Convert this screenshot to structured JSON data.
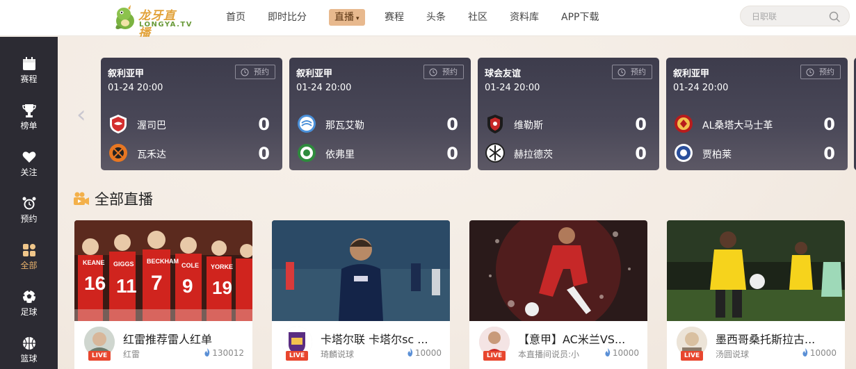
{
  "header": {
    "logo_cn": "龙牙直播",
    "logo_en": "LONGYA.TV",
    "nav": [
      {
        "label": "首页"
      },
      {
        "label": "即时比分"
      },
      {
        "label": "直播",
        "caret": "▾"
      },
      {
        "label": "赛程"
      },
      {
        "label": "头条"
      },
      {
        "label": "社区"
      },
      {
        "label": "资料库"
      },
      {
        "label": "APP下载"
      }
    ],
    "search_placeholder": "日职联"
  },
  "sidebar": {
    "items": [
      {
        "label": "赛程",
        "icon": "calendar-icon"
      },
      {
        "label": "榜单",
        "icon": "trophy-icon"
      },
      {
        "label": "关注",
        "icon": "heart-icon"
      },
      {
        "label": "预约",
        "icon": "alarm-clock-icon"
      },
      {
        "label": "全部",
        "icon": "grid-icon",
        "active": true
      },
      {
        "label": "足球",
        "icon": "football-icon"
      },
      {
        "label": "篮球",
        "icon": "basketball-icon"
      }
    ]
  },
  "matches": [
    {
      "league": "叙利亚甲",
      "time": "01-24 20:00",
      "book": "预约",
      "home": {
        "name": "渥司巴",
        "score": "0"
      },
      "away": {
        "name": "瓦禾达",
        "score": "0"
      }
    },
    {
      "league": "叙利亚甲",
      "time": "01-24 20:00",
      "book": "预约",
      "home": {
        "name": "那瓦艾勒",
        "score": "0"
      },
      "away": {
        "name": "依弗里",
        "score": "0"
      }
    },
    {
      "league": "球会友谊",
      "time": "01-24 20:00",
      "book": "预约",
      "home": {
        "name": "维勒斯",
        "score": "0"
      },
      "away": {
        "name": "赫拉德茨",
        "score": "0"
      }
    },
    {
      "league": "叙利亚甲",
      "time": "01-24 20:00",
      "book": "预约",
      "home": {
        "name": "AL桑塔大马士革",
        "score": "0"
      },
      "away": {
        "name": "贾柏莱",
        "score": "0"
      }
    }
  ],
  "section": {
    "title": "全部直播"
  },
  "live": [
    {
      "title": "红雷推荐雷人红单",
      "anchor": "红雷",
      "heat": "130012",
      "tag": "LIVE"
    },
    {
      "title": "卡塔尔联 卡塔尔sc ...",
      "anchor": "琦麟说球",
      "heat": "10000",
      "tag": "LIVE"
    },
    {
      "title": "【意甲】AC米兰VS...",
      "anchor": "本直播间说员:小",
      "heat": "10000",
      "tag": "LIVE"
    },
    {
      "title": "墨西哥桑托斯拉古...",
      "anchor": "汤圆说球",
      "heat": "10000",
      "tag": "LIVE"
    }
  ],
  "colors": {
    "accent": "#e8b98e",
    "sidebar_bg": "#2c2b33",
    "card_bg": "#3d3c4c",
    "live_red": "#e8462e",
    "active_label": "#e9b26c"
  }
}
